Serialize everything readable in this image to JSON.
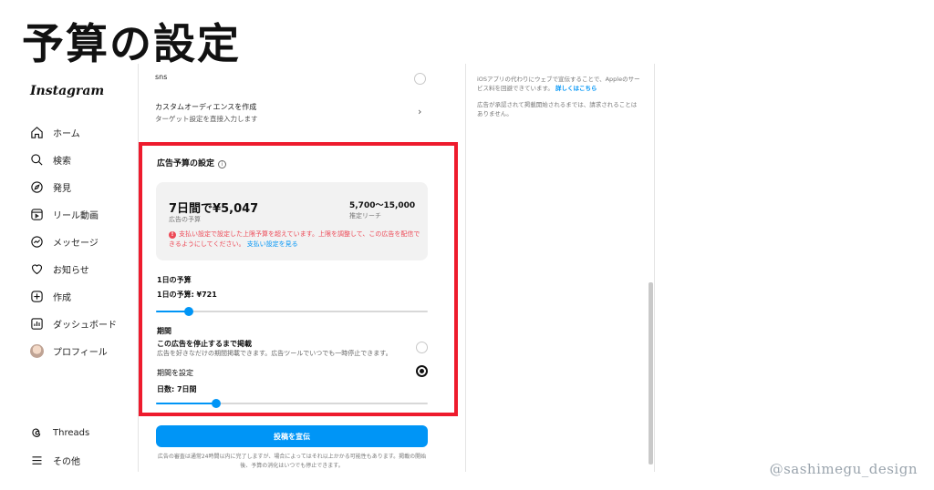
{
  "heading": "予算の設定",
  "watermark": "@sashimegu_design",
  "sidebar": {
    "logo": "Instagram",
    "items": [
      {
        "label": "ホーム",
        "icon": "home-icon"
      },
      {
        "label": "検索",
        "icon": "search-icon"
      },
      {
        "label": "発見",
        "icon": "compass-icon"
      },
      {
        "label": "リール動画",
        "icon": "reels-icon"
      },
      {
        "label": "メッセージ",
        "icon": "messenger-icon"
      },
      {
        "label": "お知らせ",
        "icon": "heart-icon"
      },
      {
        "label": "作成",
        "icon": "plus-square-icon"
      },
      {
        "label": "ダッシュボード",
        "icon": "dashboard-icon"
      },
      {
        "label": "プロフィール",
        "icon": "avatar"
      }
    ],
    "bottom": [
      {
        "label": "Threads",
        "icon": "threads-icon"
      },
      {
        "label": "その他",
        "icon": "menu-icon"
      }
    ]
  },
  "main": {
    "audience_sns": "sns",
    "custom_audience": {
      "title": "カスタムオーディエンスを作成",
      "subtitle": "ターゲット設定を直接入力します"
    },
    "budget": {
      "title": "広告予算の設定",
      "summary_amount": "7日間で¥5,047",
      "summary_amount_label": "広告の予算",
      "summary_reach": "5,700〜15,000",
      "summary_reach_label": "推定リーチ",
      "warning": "支払い設定で設定した上限予算を超えています。上限を調整して、この広告を配信できるようにしてください。",
      "warning_link": "支払い設定を見る",
      "daily_label": "1日の予算",
      "daily_value": "1日の予算: ¥721",
      "daily_slider_fraction": 0.12,
      "duration_label": "期間",
      "until_stop_title": "この広告を停止するまで掲載",
      "until_stop_sub": "広告を好きなだけの期間掲載できます。広告ツールでいつでも一時停止できます。",
      "set_duration": "期間を設定",
      "days_value": "日数: 7日間",
      "days_slider_fraction": 0.22
    },
    "boost_button": "投稿を宣伝",
    "footnote": "広告の審査は通常24時間以内に完了しますが、場合によってはそれ以上かかる可能性もあります。掲載の開始後、予算の消化はいつでも停止できます。"
  },
  "right_panel": {
    "ios_note": "iOSアプリの代わりにウェブで宣伝することで、Appleのサービス料を回避できています。",
    "ios_link": "詳しくはこちら",
    "review_note": "広告が承認されて掲載開始されるまでは、請求されることはありません。"
  },
  "colors": {
    "accent": "#0095f6",
    "highlight": "#ee1b2d",
    "warning": "#ed4956"
  }
}
